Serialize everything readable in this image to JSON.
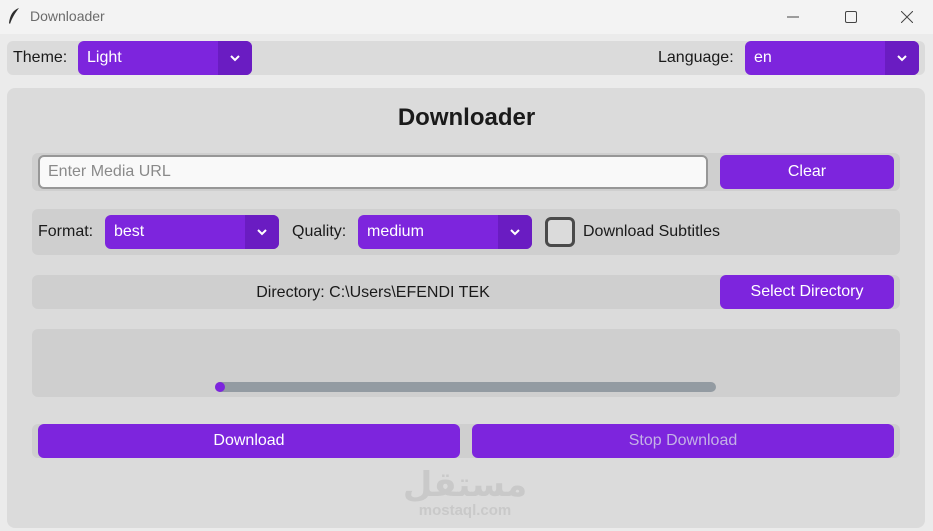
{
  "window": {
    "title": "Downloader",
    "controls": [
      "minimize",
      "maximize",
      "close"
    ]
  },
  "theme": {
    "label": "Theme:",
    "value": "Light"
  },
  "language": {
    "label": "Language:",
    "value": "en"
  },
  "main": {
    "heading": "Downloader",
    "url": {
      "placeholder": "Enter Media URL",
      "value": ""
    },
    "clear_label": "Clear",
    "format": {
      "label": "Format:",
      "value": "best"
    },
    "quality": {
      "label": "Quality:",
      "value": "medium"
    },
    "subtitles": {
      "label": "Download Subtitles",
      "checked": false
    },
    "directory": {
      "text": "Directory: C:\\Users\\EFENDI TEK",
      "button": "Select Directory"
    },
    "progress": {
      "value": 0.0
    },
    "download_label": "Download",
    "stop_label": "Stop Download"
  },
  "watermark": {
    "arabic": "مستقل",
    "latin": "mostaql.com"
  },
  "colors": {
    "accent": "#7d25dd",
    "accent_dark": "#6a1cc2",
    "progress_track": "#939ba2",
    "panel": "#dbdbdb"
  }
}
